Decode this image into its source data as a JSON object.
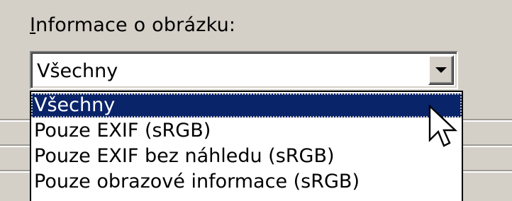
{
  "group": {
    "label_mnemonic": "I",
    "label_rest": "nformace o obrázku:"
  },
  "combo": {
    "value": "Všechny",
    "button_icon": "dropdown-arrow-icon"
  },
  "dropdown": {
    "options": [
      {
        "label": "Všechny",
        "selected": true
      },
      {
        "label": "Pouze EXIF (sRGB)",
        "selected": false
      },
      {
        "label": "Pouze EXIF bez náhledu (sRGB)",
        "selected": false
      },
      {
        "label": "Pouze obrazové informace (sRGB)",
        "selected": false
      }
    ]
  },
  "cursor": {
    "icon": "mouse-pointer-icon"
  },
  "colors": {
    "window_bg": "#d4d0c8",
    "selection_bg": "#0a246a",
    "selection_text": "#ffffff",
    "field_bg": "#ffffff"
  }
}
